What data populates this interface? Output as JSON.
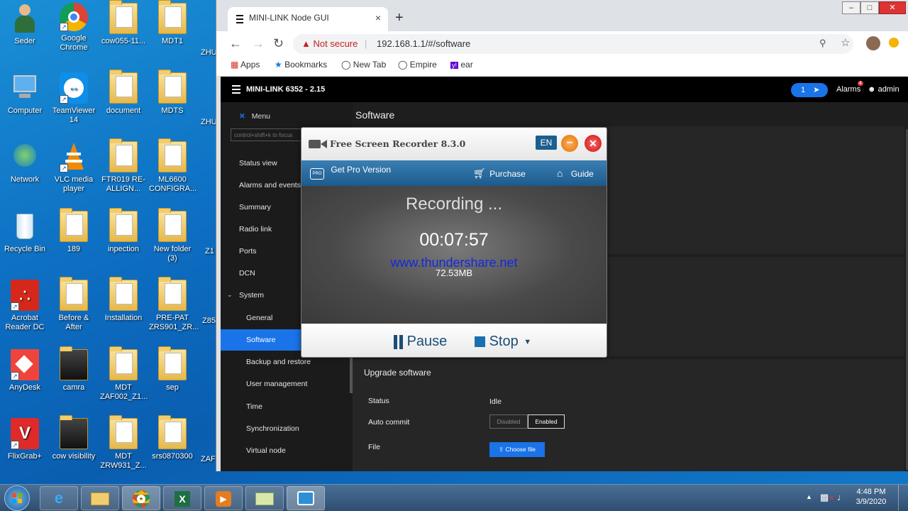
{
  "desktop": {
    "icons": [
      {
        "label": "Seder"
      },
      {
        "label": "Google Chrome"
      },
      {
        "label": "cow055-11..."
      },
      {
        "label": "MDT1"
      },
      {
        "label": "Computer"
      },
      {
        "label": "TeamViewer 14"
      },
      {
        "label": "document"
      },
      {
        "label": "MDTS"
      },
      {
        "label": "Network"
      },
      {
        "label": "VLC media player"
      },
      {
        "label": "FTR019 RE-ALLIGN..."
      },
      {
        "label": "ML6600 CONFIGRA..."
      },
      {
        "label": "Recycle Bin"
      },
      {
        "label": "189"
      },
      {
        "label": "inpection"
      },
      {
        "label": "New folder (3)"
      },
      {
        "label": "Acrobat Reader DC"
      },
      {
        "label": "Before & After"
      },
      {
        "label": "Installation"
      },
      {
        "label": "PRE-PAT ZRS901_ZR..."
      },
      {
        "label": "AnyDesk"
      },
      {
        "label": "camra"
      },
      {
        "label": "MDT ZAF002_Z1..."
      },
      {
        "label": "sep"
      },
      {
        "label": "FlixGrab+"
      },
      {
        "label": "cow visibility"
      },
      {
        "label": "MDT ZRW931_Z..."
      },
      {
        "label": "srs0870300"
      }
    ],
    "partial_labels": [
      "ZHU",
      "ZHU",
      "Z1",
      "Z85",
      "ZAF"
    ]
  },
  "browser": {
    "tab_title": "MINI-LINK Node GUI",
    "tab_close": "×",
    "new_tab": "+",
    "security_label": "Not secure",
    "url": "192.168.1.1/#/software",
    "bookmarks": [
      {
        "label": "Apps"
      },
      {
        "label": "Bookmarks"
      },
      {
        "label": "New Tab"
      },
      {
        "label": "Empire"
      },
      {
        "label": "ear"
      }
    ]
  },
  "app": {
    "product": "MINI-LINK 6352 - 2.15",
    "notif_count": "1",
    "alarms_label": "Alarms",
    "alarms_badge": "4",
    "user": "admin",
    "menu_label": "Menu",
    "search_placeholder": "control+shift+k to focus",
    "nav": {
      "status_view": "Status view",
      "alarms_events": "Alarms and events",
      "summary": "Summary",
      "radio_link": "Radio link",
      "ports": "Ports",
      "dcn": "DCN",
      "system": "System",
      "general": "General",
      "software": "Software",
      "backup": "Backup and restore",
      "user_mgmt": "User management",
      "time": "Time",
      "sync": "Synchronization",
      "virtual_node": "Virtual node"
    },
    "page_title": "Software",
    "upgrade": {
      "title": "Upgrade software",
      "status_label": "Status",
      "status_value": "Idle",
      "auto_commit_label": "Auto commit",
      "disabled": "Disabled",
      "enabled": "Enabled",
      "file_label": "File",
      "choose_file": "Choose file"
    }
  },
  "recorder": {
    "title": "Free Screen Recorder 8.3.0",
    "lang": "EN",
    "get_pro": "Get Pro Version",
    "purchase": "Purchase",
    "guide": "Guide",
    "status": "Recording ...",
    "elapsed": "00:07:57",
    "watermark": "www.thundershare.net",
    "size": "72.53MB",
    "pause": "Pause",
    "stop": "Stop"
  },
  "taskbar": {
    "time": "4:48 PM",
    "date": "3/9/2020"
  }
}
